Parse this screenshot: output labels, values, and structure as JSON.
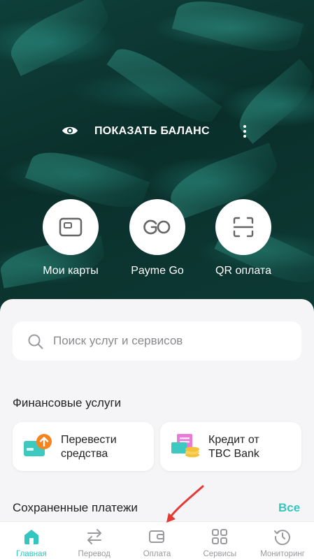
{
  "balance": {
    "label": "ПОКАЗАТЬ БАЛАНС",
    "menu_icon": "more-vertical-icon",
    "eye_icon": "eye-icon"
  },
  "quick_actions": [
    {
      "label": "Мои карты",
      "icon": "card-icon"
    },
    {
      "label": "Payme Go",
      "icon": "payme-go-logo-icon"
    },
    {
      "label": "QR оплата",
      "icon": "qr-scan-icon"
    }
  ],
  "search": {
    "placeholder": "Поиск услуг и сервисов"
  },
  "financial_services": {
    "title": "Финансовые услуги",
    "cards": [
      {
        "line1": "Перевести",
        "line2": "средства",
        "icon": "transfer-card-icon"
      },
      {
        "line1": "Кредит от",
        "line2": "TBC Bank",
        "icon": "credit-icon"
      }
    ]
  },
  "saved_payments": {
    "title": "Сохраненные платежи",
    "all_label": "Все"
  },
  "tabbar": [
    {
      "label": "Главная",
      "icon": "home-icon",
      "active": true
    },
    {
      "label": "Перевод",
      "icon": "transfer-arrows-icon",
      "active": false
    },
    {
      "label": "Оплата",
      "icon": "wallet-icon",
      "active": false
    },
    {
      "label": "Сервисы",
      "icon": "grid-icon",
      "active": false
    },
    {
      "label": "Мониторинг",
      "icon": "history-icon",
      "active": false
    }
  ],
  "colors": {
    "accent": "#33c6c0",
    "hero_dark": "#0a2f2b",
    "annotation_arrow": "#e53935"
  }
}
